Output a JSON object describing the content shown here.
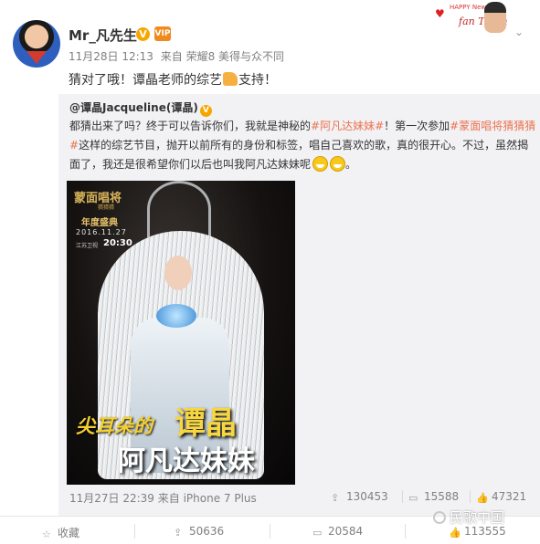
{
  "post": {
    "username": "Mr_凡先生",
    "verified_badge": "V",
    "vip_badge": "VIP",
    "timestamp": "11月28日 12:13",
    "source": "来自 荣耀8 美得与众不同",
    "text_before": "猜对了哦！谭晶老师的综艺",
    "text_after": "支持！"
  },
  "banner": {
    "top_text": "HAPPY New",
    "name_text": "fan Tiffan"
  },
  "repost": {
    "author": "@谭晶Jacqueline(谭晶)",
    "verified_badge": "V",
    "text_1": "都猜出来了吗？终于可以告诉你们，我就是神秘的",
    "tag_1": "#阿凡达妹妹#",
    "text_2": "！第一次参加",
    "tag_2": "#蒙面唱将猜猜猜#",
    "text_3": "这样的综艺节目，抛开以前所有的身份和标签，唱自己喜欢的歌，真的很开心。不过，虽然揭面了，我还是很希望你们以后也叫我阿凡达妹妹呢",
    "poster": {
      "show_logo": "蒙面唱将",
      "show_sub": "猜猜猜",
      "event": "年度盛典",
      "date": "2016.11.27",
      "channel": "江苏卫视",
      "time": "20:30",
      "big1": "尖耳朵的",
      "big2": "谭晶",
      "big3": "阿凡达妹妹"
    },
    "timestamp": "11月27日 22:39",
    "source": "来自 iPhone 7 Plus",
    "reposts": "130453",
    "comments": "15588",
    "likes": "47321"
  },
  "footer": {
    "favorite_label": "收藏",
    "reposts": "50636",
    "comments": "20584",
    "likes": "113555"
  },
  "watermark": "民歌中国",
  "colors": {
    "tag": "#eb7350",
    "meta": "#808080",
    "repost_bg": "#f2f2f5",
    "badge": "#f7a600"
  }
}
